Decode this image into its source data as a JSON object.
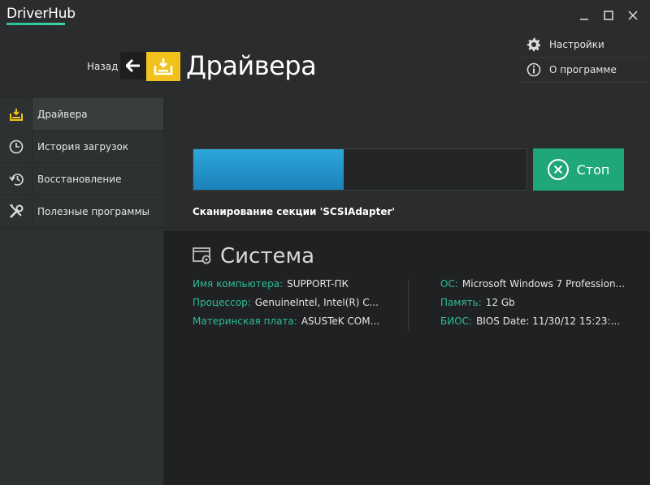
{
  "app": {
    "title": "DriverHub"
  },
  "window_controls": {
    "minimize": "minimize",
    "maximize": "maximize",
    "close": "close"
  },
  "header": {
    "back_label": "Назад",
    "page_title": "Драйвера",
    "menu": [
      {
        "label": "Настройки",
        "icon": "gear-icon"
      },
      {
        "label": "О программе",
        "icon": "info-icon"
      }
    ]
  },
  "sidebar": {
    "items": [
      {
        "label": "Драйвера",
        "icon": "drive-icon",
        "active": true
      },
      {
        "label": "История загрузок",
        "icon": "clock-icon",
        "active": false
      },
      {
        "label": "Восстановление",
        "icon": "restore-icon",
        "active": false
      },
      {
        "label": "Полезные программы",
        "icon": "tools-icon",
        "active": false
      }
    ]
  },
  "scan": {
    "progress": 0.45,
    "stop_label": "Стоп",
    "status": "Сканирование секции 'SCSIAdapter'"
  },
  "system": {
    "title": "Система",
    "left": [
      {
        "key": "Имя компьютера:",
        "value": "SUPPORT-ПК"
      },
      {
        "key": "Процессор:",
        "value": "GenuineIntel, Intel(R) C..."
      },
      {
        "key": "Материнская плата:",
        "value": "ASUSTeK COM..."
      }
    ],
    "right": [
      {
        "key": "ОС:",
        "value": "Microsoft Windows 7 Profession..."
      },
      {
        "key": "Память:",
        "value": "12 Gb"
      },
      {
        "key": "БИОС:",
        "value": "BIOS Date: 11/30/12 15:23:..."
      }
    ]
  },
  "colors": {
    "accent_green": "#1fa77b",
    "accent_yellow": "#f1c21b",
    "progress_blue": "#2ea6dc",
    "label_green": "#2bbf9a"
  }
}
